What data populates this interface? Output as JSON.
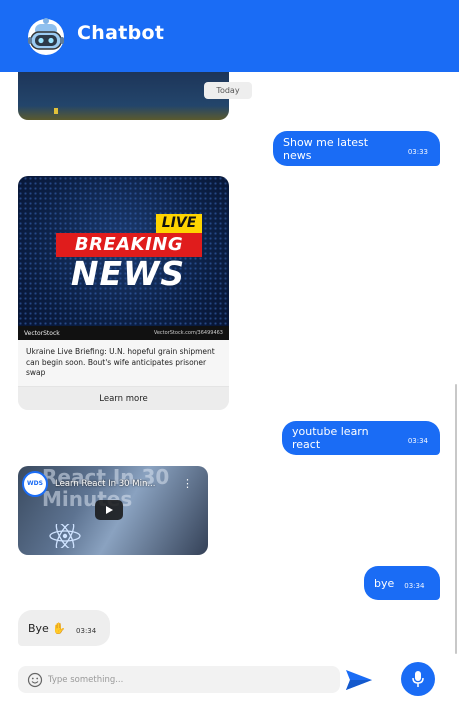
{
  "header": {
    "title": "Chatbot",
    "logo_icon": "robot-icon",
    "background": "#1a6cf5"
  },
  "chat": {
    "date_divider": "Today",
    "messages": [
      {
        "from": "user",
        "text": "Show me latest news",
        "time": "03:33"
      },
      {
        "from": "bot",
        "type": "news-card",
        "image_text": {
          "live": "LIVE",
          "breaking": "BREAKING",
          "news": "NEWS",
          "brand": "VectorStock",
          "watermark": "VectorStock.com/36499463"
        },
        "caption": "Ukraine Live Briefing: U.N. hopeful grain shipment can begin soon. Bout's wife anticipates prisoner swap",
        "action_label": "Learn more"
      },
      {
        "from": "user",
        "text": "youtube learn react",
        "time": "03:34"
      },
      {
        "from": "bot",
        "type": "video",
        "video_title": "Learn React In 30 Min...",
        "channel_badge": "WDS",
        "bg_text": "React In 30 Minutes"
      },
      {
        "from": "user",
        "text": "bye",
        "time": "03:34"
      },
      {
        "from": "bot",
        "text": "Bye ✋",
        "time": "03:34"
      }
    ]
  },
  "composer": {
    "placeholder": "Type something...",
    "value": "",
    "emoji_icon": "smiley-icon",
    "send_icon": "send-icon",
    "mic_icon": "microphone-icon"
  }
}
